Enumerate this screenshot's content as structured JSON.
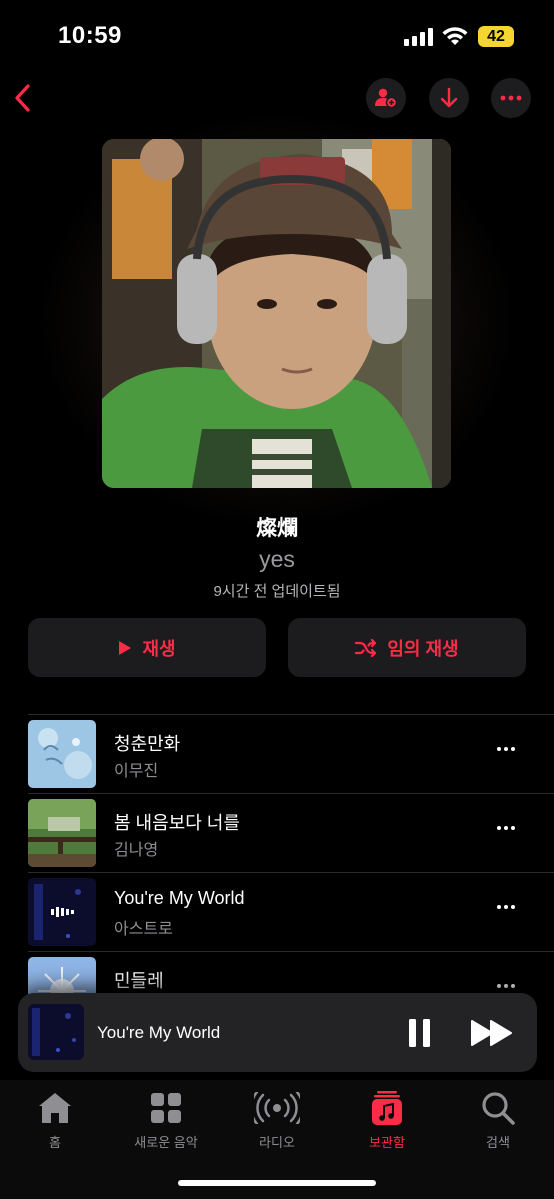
{
  "status_bar": {
    "time": "10:59",
    "battery": "42"
  },
  "playlist": {
    "title": "燦爛",
    "curator": "yes",
    "updated": "9시간 전 업데이트됨",
    "play_label": "재생",
    "shuffle_label": "임의 재생"
  },
  "header": {
    "back_icon": "chevron-left-icon",
    "add_person_icon": "person-add-icon",
    "download_icon": "download-icon",
    "more_icon": "more-icon"
  },
  "songs": [
    {
      "title": "청춘만화",
      "artist": "이무진"
    },
    {
      "title": "봄 내음보다 너를",
      "artist": "김나영"
    },
    {
      "title": "You're My World",
      "artist": "아스트로"
    },
    {
      "title": "민들레",
      "artist": ""
    }
  ],
  "now_playing": {
    "title": "You're My World"
  },
  "tabs": [
    {
      "label": "홈",
      "icon": "home-icon"
    },
    {
      "label": "새로운 음악",
      "icon": "grid-icon"
    },
    {
      "label": "라디오",
      "icon": "radio-icon"
    },
    {
      "label": "보관함",
      "icon": "library-icon",
      "active": true
    },
    {
      "label": "검색",
      "icon": "search-icon"
    }
  ],
  "colors": {
    "accent": "#fa2d48",
    "battery": "#f6d533"
  }
}
